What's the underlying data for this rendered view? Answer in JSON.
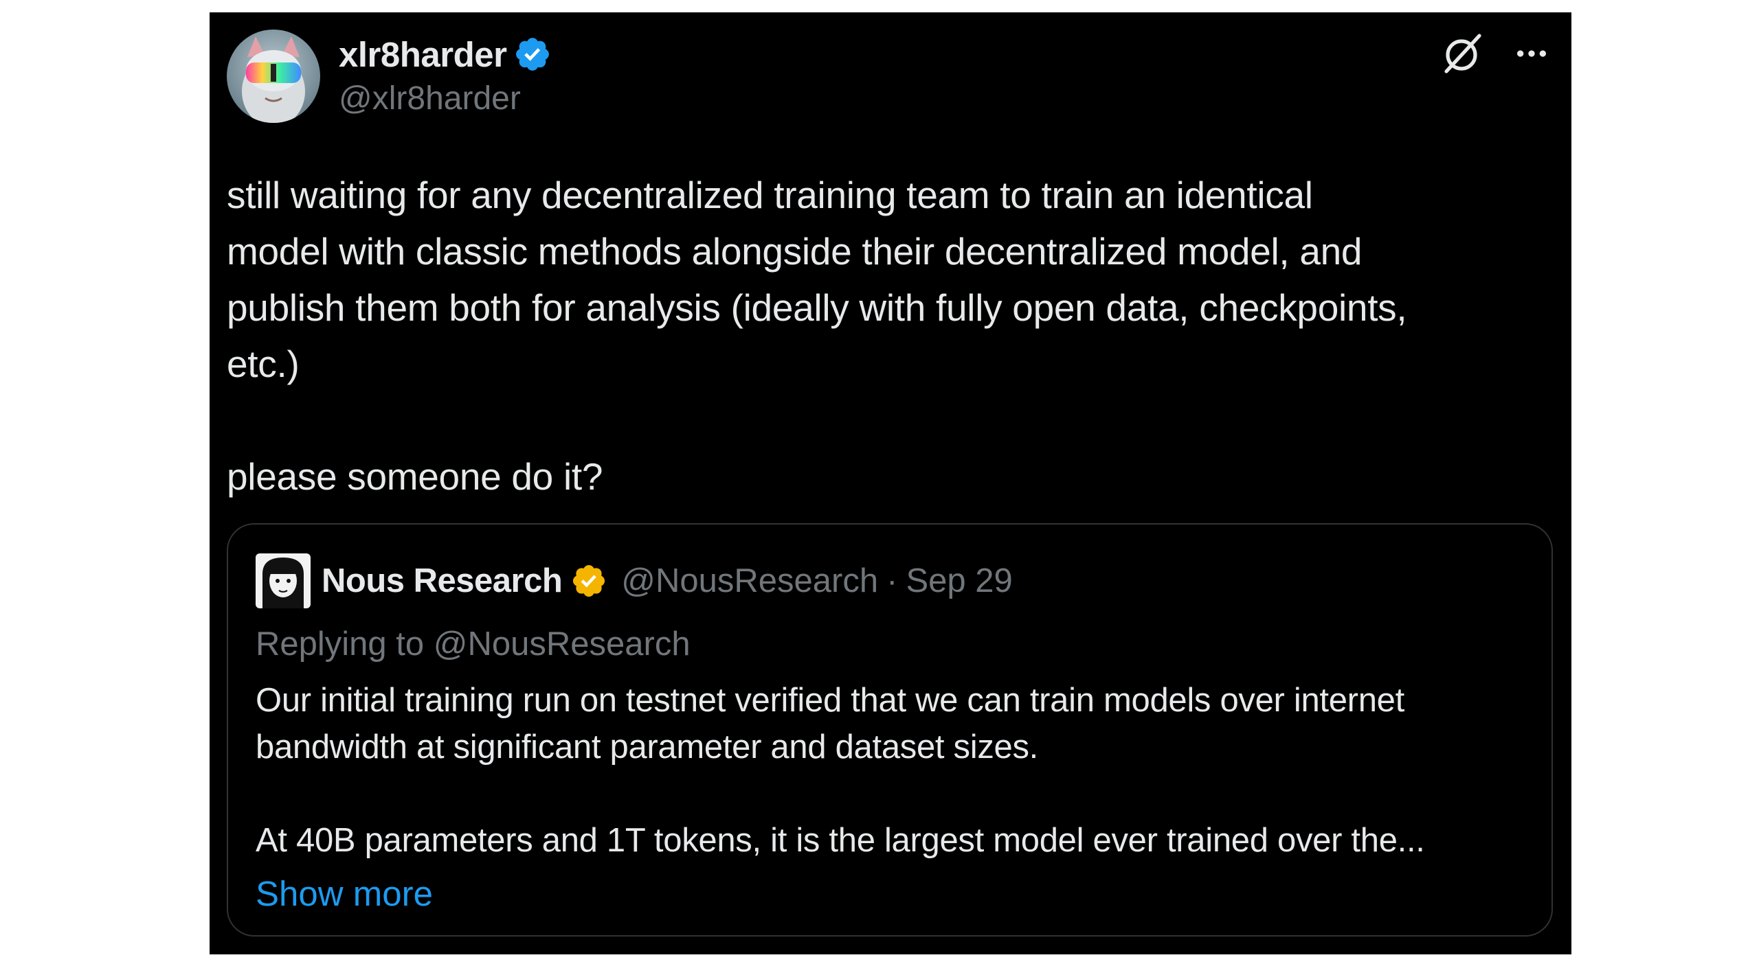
{
  "tweet": {
    "display_name": "xlr8harder",
    "handle": "@xlr8harder",
    "verified": true,
    "badge_color": "#1d9bf0",
    "text": "still waiting for any decentralized training team to train an identical\nmodel with classic methods alongside their decentralized model, and\npublish them both for analysis (ideally with fully open data, checkpoints,\netc.)\n\nplease someone do it?"
  },
  "quoted_tweet": {
    "display_name": "Nous Research",
    "handle": "@NousResearch",
    "separator": "·",
    "date": "Sep 29",
    "verified": true,
    "badge_color": "#f4b400",
    "replying_to": "Replying to @NousResearch",
    "text": "Our initial training run on testnet verified that we can train models over internet\nbandwidth at significant parameter and dataset sizes.\n\nAt 40B parameters and 1T tokens, it is the largest model ever trained over the...",
    "show_more": "Show more"
  },
  "icons": [
    "grok-icon",
    "more-options-icon",
    "verified-badge-icon",
    "gold-verified-badge-icon"
  ],
  "colors": {
    "background": "#000000",
    "text": "#e7e9ea",
    "secondary_text": "#71767b",
    "link": "#1d9bf0",
    "border": "#2f3336"
  }
}
